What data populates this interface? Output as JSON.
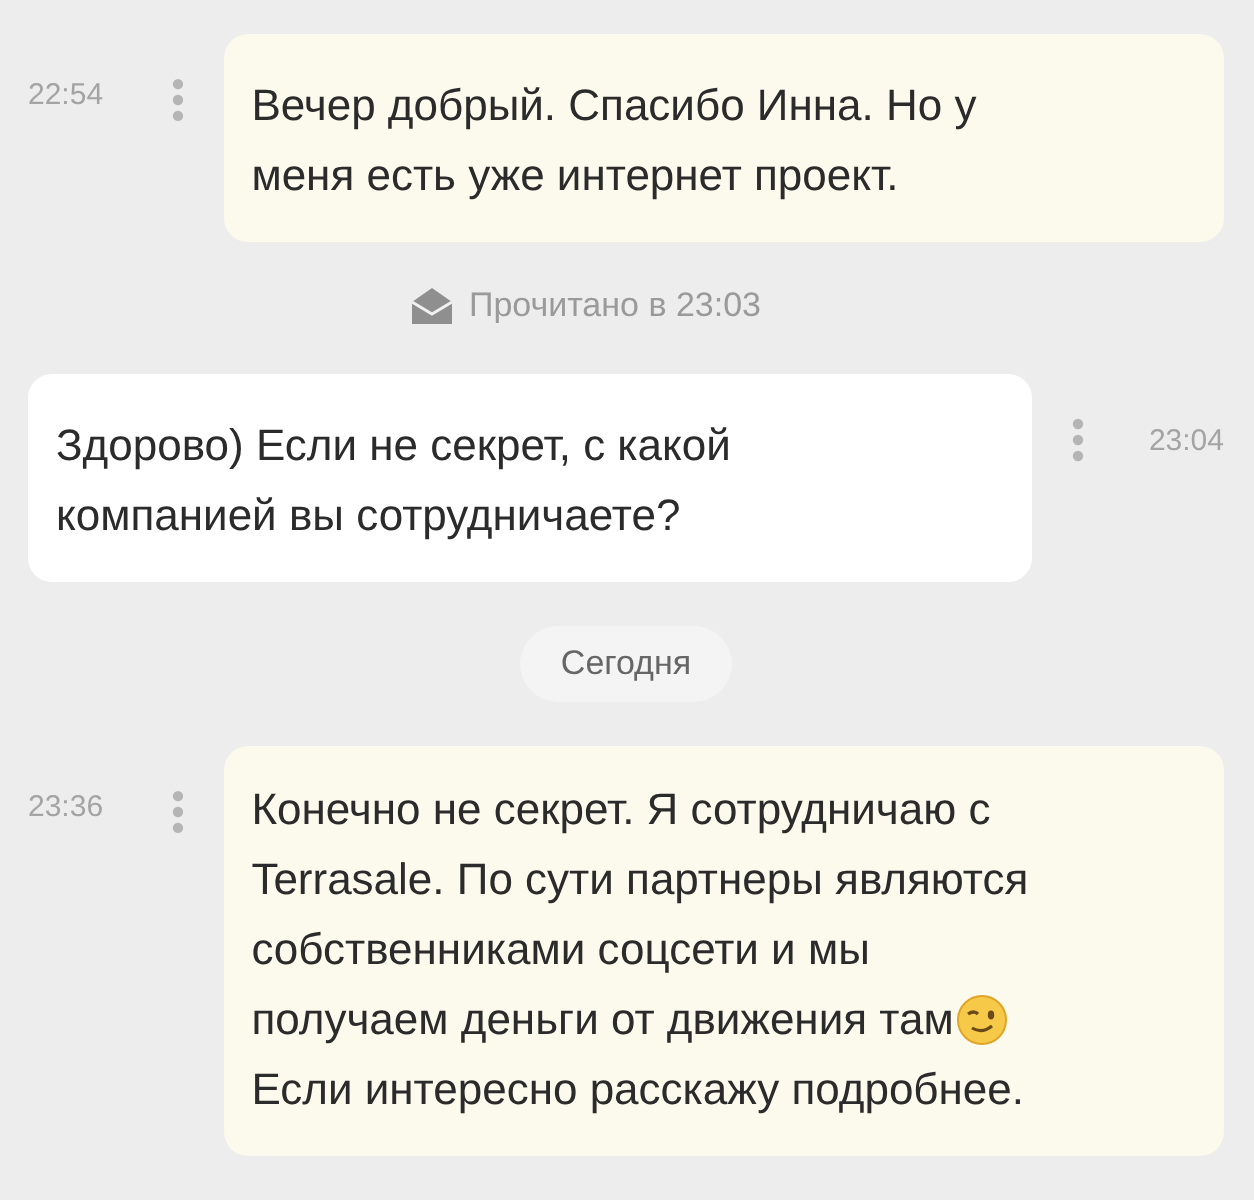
{
  "messages": [
    {
      "kind": "outgoing",
      "time": "22:54",
      "lines": [
        {
          "text": "Вечер добрый. Спасибо Инна. Но у",
          "emoji": false
        },
        {
          "text": "меня есть уже интернет проект.",
          "emoji": false
        }
      ]
    },
    {
      "kind": "read_receipt",
      "text": "Прочитано в 23:03"
    },
    {
      "kind": "incoming",
      "time": "23:04",
      "lines": [
        {
          "text": "Здорово) Если не секрет, с какой",
          "emoji": false
        },
        {
          "text": "компанией вы сотрудничаете?",
          "emoji": false
        }
      ]
    },
    {
      "kind": "date",
      "text": "Сегодня"
    },
    {
      "kind": "outgoing",
      "time": "23:36",
      "lines": [
        {
          "text": "Конечно не секрет. Я сотрудничаю с",
          "emoji": false
        },
        {
          "text": "Terrasale. По сути партнеры являются",
          "emoji": false
        },
        {
          "text": "собственниками соцсети и мы",
          "emoji": false
        },
        {
          "text": "получаем деньги от движения там",
          "emoji": true
        },
        {
          "text": "Если интересно расскажу подробнее.",
          "emoji": false
        }
      ]
    }
  ]
}
